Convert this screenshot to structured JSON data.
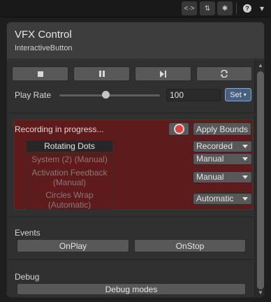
{
  "toolbar": {
    "code_icon_glyph": "<·>",
    "unpin_icon_glyph": "⇅",
    "bug_icon_glyph": "✱",
    "help_icon_glyph": "?",
    "menu_caret_glyph": "▾"
  },
  "window": {
    "title": "VFX Control",
    "subtitle": "InteractiveButton"
  },
  "playback": {
    "stop_icon": "stop-icon",
    "pause_icon": "pause-icon",
    "step_icon": "step-forward-icon",
    "restart_icon": "restart-icon"
  },
  "play_rate": {
    "label": "Play Rate",
    "value": "100",
    "slider_level_percent": 45,
    "set_button": "Set",
    "set_caret": "▾"
  },
  "recording": {
    "status": "Recording in progress...",
    "apply_bounds": "Apply Bounds",
    "rows": [
      {
        "name": "Rotating Dots",
        "mode": "Recorded"
      },
      {
        "name": "System (2) (Manual)",
        "mode": "Manual"
      },
      {
        "name_line1": "Activation Feedback",
        "name_line2": "(Manual)",
        "mode": "Manual"
      },
      {
        "name_line1": "Circles Wrap",
        "name_line2": "(Automatic)",
        "mode": "Automatic"
      }
    ]
  },
  "events": {
    "label": "Events",
    "buttons": [
      "OnPlay",
      "OnStop"
    ]
  },
  "debug": {
    "label": "Debug",
    "button": "Debug modes"
  },
  "colors": {
    "panel": "#383838",
    "recording_bg": "#5d1b1b",
    "set_button": "#46607f",
    "record_dot": "#e43d3d"
  }
}
